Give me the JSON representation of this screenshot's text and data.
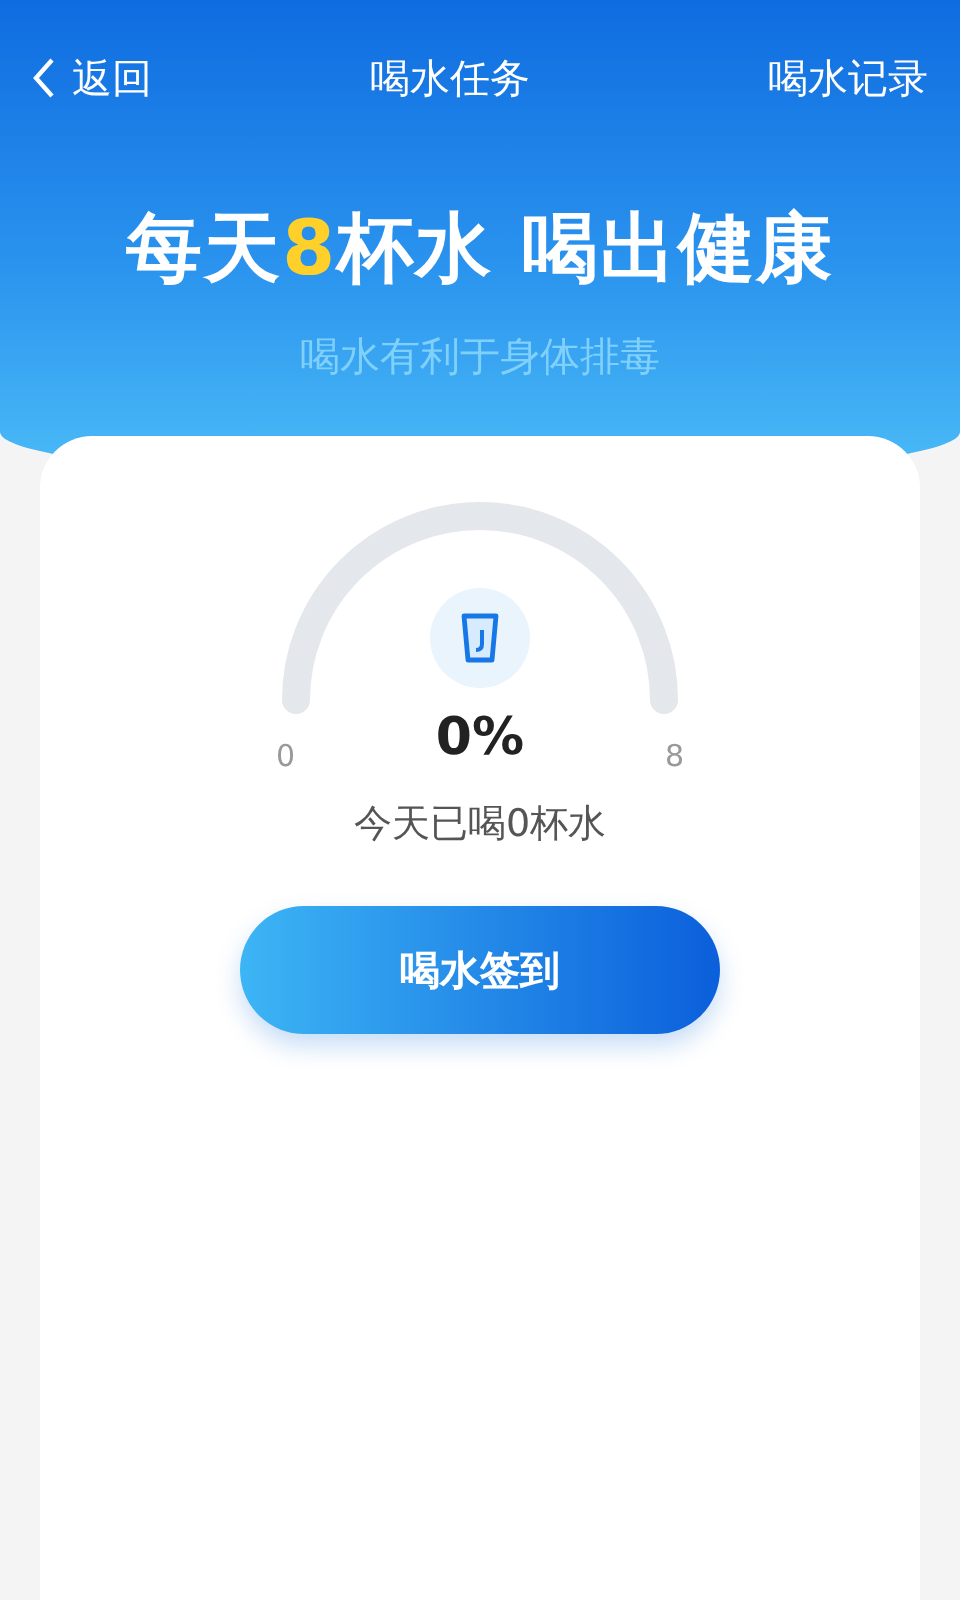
{
  "nav": {
    "back": "返回",
    "title": "喝水任务",
    "action": "喝水记录"
  },
  "banner": {
    "headline": "每天**8**杯水 喝出健康",
    "subtitle": "喝水有利于身体排毒"
  },
  "gauge": {
    "min": "0",
    "max": "8",
    "percent": "0%"
  },
  "today": "今天已喝0杯水",
  "checkin_button": "喝水签到"
}
